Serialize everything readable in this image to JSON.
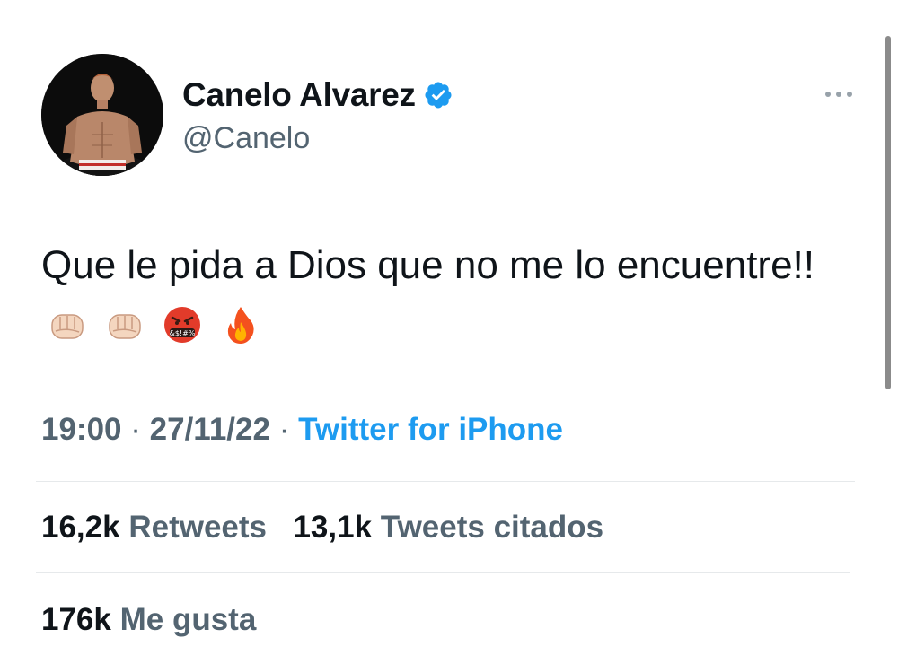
{
  "author": {
    "display_name": "Canelo Alvarez",
    "handle": "@Canelo",
    "verified_icon": "verified-badge-icon",
    "avatar": "avatar"
  },
  "tweet": {
    "text": "Que le pida a Dios que no me lo encuentre!!",
    "emojis": [
      "oncoming-fist-icon",
      "oncoming-fist-icon",
      "face-with-symbols-on-mouth-icon",
      "fire-icon"
    ]
  },
  "meta": {
    "time": "19:00",
    "separator": "·",
    "date": "27/11/22",
    "source": "Twitter for iPhone"
  },
  "stats": {
    "retweets_count": "16,2k",
    "retweets_label": "Retweets",
    "quotes_count": "13,1k",
    "quotes_label": "Tweets citados",
    "likes_count": "176k",
    "likes_label": "Me gusta"
  },
  "colors": {
    "text": "#0f1419",
    "secondary": "#536471",
    "accent": "#1d9bf0",
    "divider": "#e6e9eb"
  },
  "more_icon": "more-options-icon"
}
